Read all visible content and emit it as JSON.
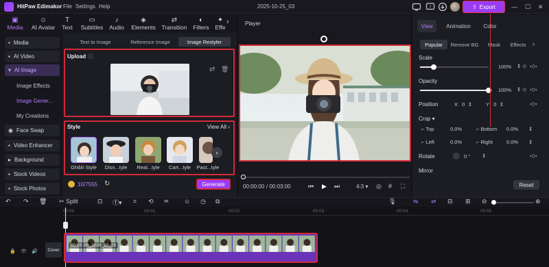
{
  "titlebar": {
    "app_name": "HitPaw Edimakor",
    "menu": [
      "File",
      "Settings",
      "Help"
    ],
    "doc_title": "2025-10-25_03",
    "export_label": "Export",
    "window_controls": [
      "—",
      "☐",
      "✕"
    ]
  },
  "toolbar": {
    "items": [
      {
        "label": "Media",
        "icon": "media-icon",
        "active": true
      },
      {
        "label": "AI Avatar",
        "icon": "ai-avatar-icon"
      },
      {
        "label": "Text",
        "icon": "text-icon"
      },
      {
        "label": "Subtitles",
        "icon": "subtitles-icon"
      },
      {
        "label": "Audio",
        "icon": "audio-icon"
      },
      {
        "label": "Elements",
        "icon": "elements-icon"
      },
      {
        "label": "Transition",
        "icon": "transition-icon"
      },
      {
        "label": "Filters",
        "icon": "filters-icon"
      },
      {
        "label": "Effe",
        "icon": "effects-icon"
      }
    ]
  },
  "sidebar": {
    "items": [
      {
        "label": "Media"
      },
      {
        "label": "AI Video"
      },
      {
        "label": "AI Image",
        "active": true
      }
    ],
    "sub_items": [
      {
        "label": "Image Effects"
      },
      {
        "label": "Image Gener...",
        "active": true
      },
      {
        "label": "My Creations"
      }
    ],
    "items_bottom": [
      {
        "label": "Face Swap"
      },
      {
        "label": "Video Enhancer"
      },
      {
        "label": "Background"
      },
      {
        "label": "Stock Videos"
      },
      {
        "label": "Stock Photos"
      }
    ]
  },
  "center": {
    "tabs": [
      "Text to Image",
      "Reference Image",
      "Image Restyler"
    ],
    "upload_title": "Upload",
    "style_title": "Style",
    "view_all": "View All",
    "styles": [
      {
        "label": "Ghibli Style"
      },
      {
        "label": "Disn...tyle"
      },
      {
        "label": "Real...tyle"
      },
      {
        "label": "Cart...tyle"
      },
      {
        "label": "Past...tyle"
      }
    ],
    "credits": "10/7555",
    "generate_label": "Generate"
  },
  "player": {
    "title": "Player",
    "current_time": "00:00:00",
    "total_time": "/ 00:03:00",
    "aspect": "4:3"
  },
  "right": {
    "tabs": [
      "View",
      "Animation",
      "Color"
    ],
    "sub_tabs": [
      "Popular",
      "Remove BG",
      "Mask",
      "Effects"
    ],
    "scale_label": "Scale",
    "scale_value": "100%",
    "opacity_label": "Opacity",
    "opacity_value": "100%",
    "position_label": "Position",
    "pos_x_label": "X",
    "pos_x": "0",
    "pos_y_label": "Y",
    "pos_y": "0",
    "crop_label": "Crop",
    "crop_top_label": "Top",
    "crop_top": "0.0%",
    "crop_bottom_label": "Bottom",
    "crop_bottom": "0.0%",
    "crop_left_label": "Left",
    "crop_left": "0.0%",
    "crop_right_label": "Right",
    "crop_right": "0.0%",
    "rotate_label": "Rotate",
    "rotate_value": "0 °",
    "mirror_label": "Mirror",
    "reset_label": "Reset"
  },
  "timeline": {
    "split_label": "Split",
    "ticks": [
      "00:00",
      "00:01",
      "00:02",
      "00:03",
      "00:04",
      "00:05"
    ],
    "clip_label": "00:03  2R_2025_10_25",
    "cover_label": "Cover"
  },
  "colors": {
    "accent": "#9b3cf5",
    "highlight_box": "#d42a38"
  }
}
